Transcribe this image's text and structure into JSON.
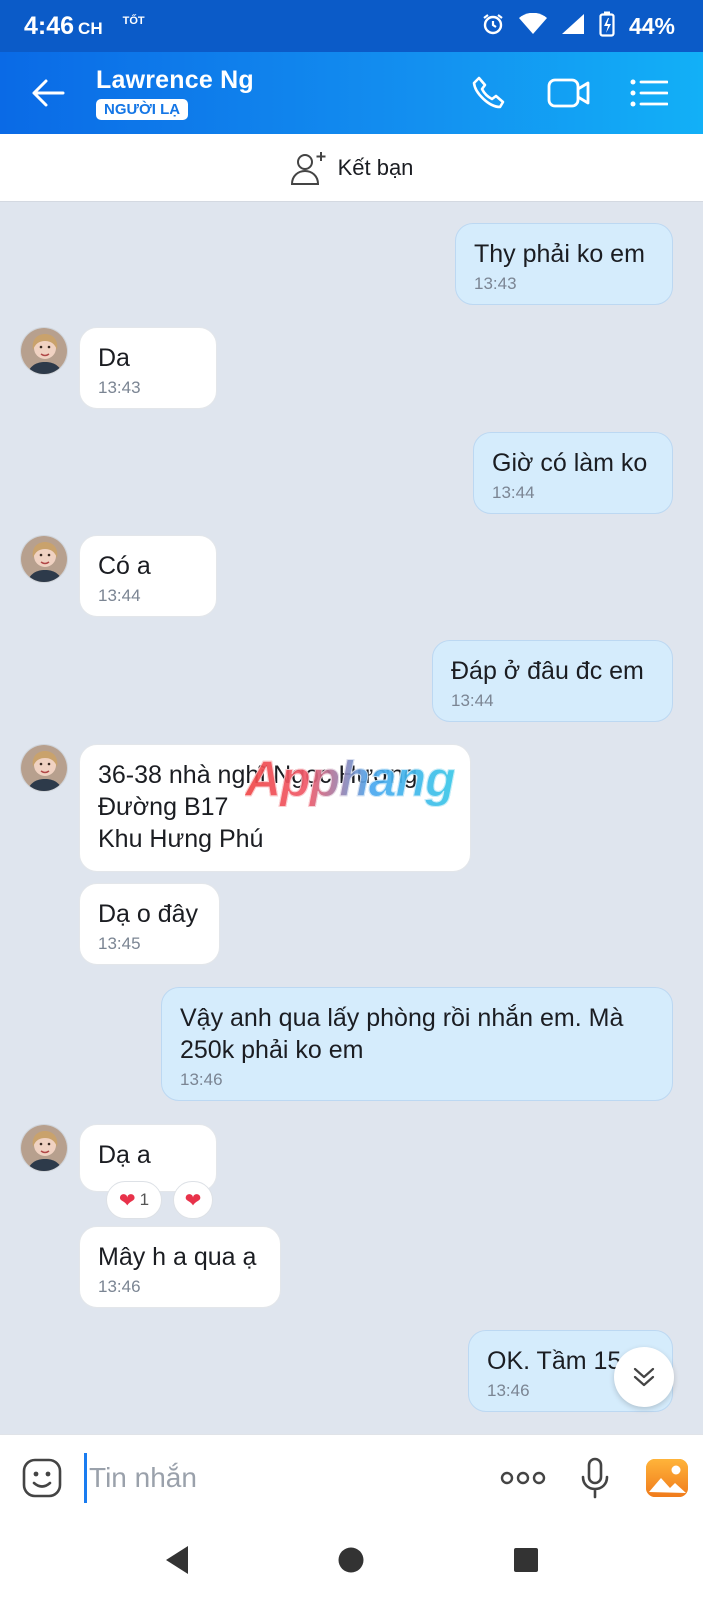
{
  "status_bar": {
    "time": "4:46",
    "ampm": "CH",
    "tag": "TỐT",
    "battery": "44%"
  },
  "header": {
    "contact_name": "Lawrence Ng",
    "badge": "NGƯỜI LẠ"
  },
  "add_friend": {
    "label": "Kết bạn"
  },
  "watermark": "Apphang",
  "messages": [
    {
      "text": "Thy phải ko em",
      "time": "13:43"
    },
    {
      "text": "Da",
      "time": "13:43"
    },
    {
      "text": "Giờ có làm ko",
      "time": "13:44"
    },
    {
      "text": "Có a",
      "time": "13:44"
    },
    {
      "text": "Đáp ở đâu đc em",
      "time": "13:44"
    },
    {
      "text": "36-38 nhà nghĩ Ngọc Hương\nĐường B17\nKhu Hưng Phú",
      "time": ""
    },
    {
      "text": "Dạ o đây",
      "time": "13:45"
    },
    {
      "text": "Vậy anh qua lấy phòng rồi nhắn em. Mà 250k phải ko em",
      "time": "13:46"
    },
    {
      "text": "Dạ a",
      "time": ""
    },
    {
      "text": "Mây h a qua ạ",
      "time": "13:46"
    },
    {
      "text": "OK. Tầm 15",
      "time": "13:46"
    }
  ],
  "reactions": {
    "heart_count": "1",
    "heart_glyph": "❤"
  },
  "input": {
    "placeholder": "Tin nhắn"
  },
  "colors": {
    "primary": "#0a6ae6",
    "outgoing_bubble": "#d5ecfc",
    "chat_bg": "#dfe5ee"
  }
}
